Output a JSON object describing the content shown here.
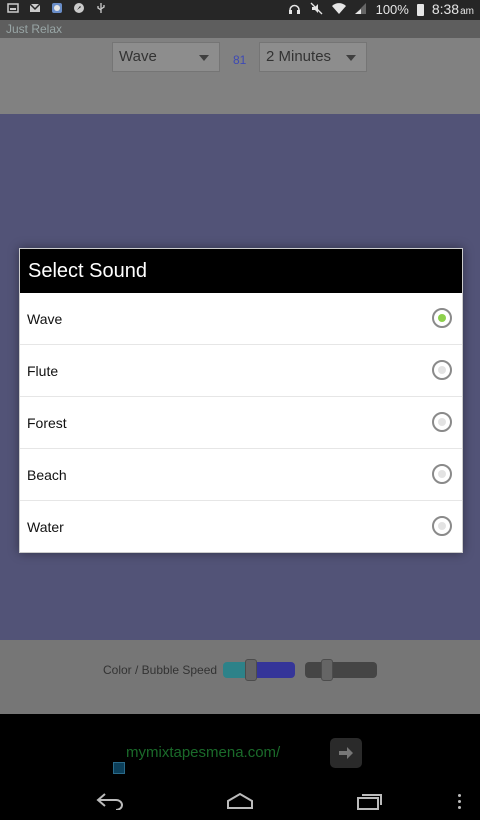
{
  "status_bar": {
    "left_icons": [
      "image-icon",
      "gmail-icon",
      "app-icon",
      "compass-icon",
      "usb-icon"
    ],
    "right_icons": [
      "headset-icon",
      "mute-icon",
      "wifi-icon",
      "signal-icon"
    ],
    "battery": "100%",
    "time": "8:38",
    "ampm": "am"
  },
  "app": {
    "title": "Just Relax",
    "sound_select": "Wave",
    "counter": "81",
    "duration_select": "2 Minutes",
    "speed_label": "Color / Bubble Speed"
  },
  "dialog": {
    "title": "Select Sound",
    "options": [
      {
        "label": "Wave",
        "selected": true
      },
      {
        "label": "Flute",
        "selected": false
      },
      {
        "label": "Forest",
        "selected": false
      },
      {
        "label": "Beach",
        "selected": false
      },
      {
        "label": "Water",
        "selected": false
      }
    ]
  },
  "ad": {
    "text": "mymixtapesmena.com/"
  },
  "colors": {
    "selected_radio": "#8dd04c",
    "dialog_title_bg": "#000000"
  }
}
